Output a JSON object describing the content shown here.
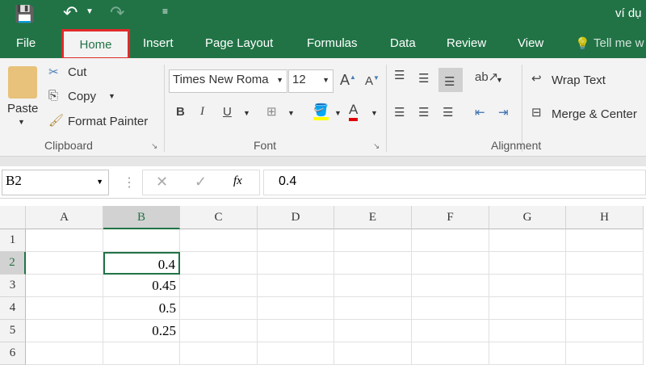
{
  "title_bar": {
    "doc_title": "ví dụ"
  },
  "tabs": [
    "File",
    "Home",
    "Insert",
    "Page Layout",
    "Formulas",
    "Data",
    "Review",
    "View"
  ],
  "tell_me": "Tell me w",
  "clipboard": {
    "paste": "Paste",
    "cut": "Cut",
    "copy": "Copy",
    "format_painter": "Format Painter",
    "group": "Clipboard"
  },
  "font": {
    "name": "Times New Roma",
    "size": "12",
    "group": "Font",
    "bold": "B",
    "italic": "I",
    "underline": "U",
    "font_color": "#e00000",
    "highlight_color": "#ffff00"
  },
  "alignment": {
    "wrap_text": "Wrap Text",
    "merge_center": "Merge & Center",
    "group": "Alignment"
  },
  "formula_bar": {
    "name_box": "B2",
    "fx": "fx",
    "value": "0.4"
  },
  "grid": {
    "columns": [
      "A",
      "B",
      "C",
      "D",
      "E",
      "F",
      "G",
      "H"
    ],
    "rows": [
      "1",
      "2",
      "3",
      "4",
      "5",
      "6"
    ],
    "cells": {
      "B2": "0.4",
      "B3": "0.45",
      "B4": "0.5",
      "B5": "0.25"
    },
    "selected": "B2"
  }
}
